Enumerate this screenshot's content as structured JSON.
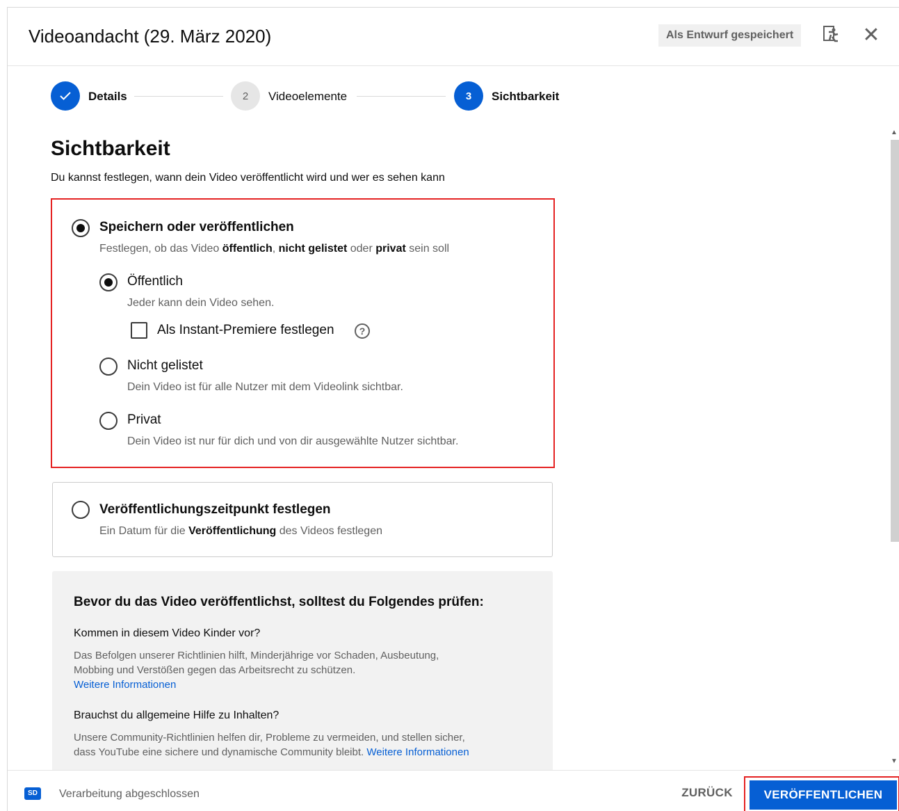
{
  "header": {
    "title": "Videoandacht (29. März 2020)",
    "draft_badge": "Als Entwurf gespeichert",
    "feedback_icon": "feedback-icon",
    "close_icon": "close-icon"
  },
  "stepper": {
    "steps": [
      {
        "label": "Details",
        "state": "done",
        "number": "✓"
      },
      {
        "label": "Videoelemente",
        "state": "todo",
        "number": "2"
      },
      {
        "label": "Sichtbarkeit",
        "state": "active",
        "number": "3"
      }
    ]
  },
  "visibility": {
    "title": "Sichtbarkeit",
    "subtitle": "Du kannst festlegen, wann dein Video veröffentlicht wird und wer es sehen kann",
    "save_option": {
      "label": "Speichern oder veröffentlichen",
      "desc_prefix": "Festlegen, ob das Video ",
      "desc_b1": "öffentlich",
      "desc_sep1": ", ",
      "desc_b2": "nicht gelistet",
      "desc_mid": " oder ",
      "desc_b3": "privat",
      "desc_suffix": " sein soll",
      "selected": true
    },
    "public": {
      "label": "Öffentlich",
      "desc": "Jeder kann dein Video sehen.",
      "selected": true
    },
    "premiere": {
      "label": "Als Instant-Premiere festlegen",
      "checked": false,
      "help_icon": "?"
    },
    "unlisted": {
      "label": "Nicht gelistet",
      "desc": "Dein Video ist für alle Nutzer mit dem Videolink sichtbar.",
      "selected": false
    },
    "private": {
      "label": "Privat",
      "desc": "Dein Video ist nur für dich und von dir ausgewählte Nutzer sichtbar.",
      "selected": false
    },
    "schedule": {
      "label": "Veröffentlichungszeitpunkt festlegen",
      "desc_prefix": "Ein Datum für die ",
      "desc_bold": "Veröffentlichung",
      "desc_suffix": " des Videos festlegen",
      "selected": false
    }
  },
  "info": {
    "title": "Bevor du das Video veröffentlichst, solltest du Folgendes prüfen:",
    "q1": "Kommen in diesem Video Kinder vor?",
    "a1": "Das Befolgen unserer Richtlinien hilft, Minderjährige vor Schaden, Ausbeutung, Mobbing und Verstößen gegen das Arbeitsrecht zu schützen.",
    "a1_link": "Weitere Informationen",
    "q2": "Brauchst du allgemeine Hilfe zu Inhalten?",
    "a2": "Unsere Community-Richtlinien helfen dir, Probleme zu vermeiden, und stellen sicher, dass YouTube eine sichere und dynamische Community bleibt.",
    "a2_link": "Weitere Informationen"
  },
  "footer": {
    "sd_badge": "SD",
    "status": "Verarbeitung abgeschlossen",
    "back": "ZURÜCK",
    "publish": "VERÖFFENTLICHEN"
  },
  "colors": {
    "accent": "#065fd4",
    "highlight": "#e52222"
  }
}
